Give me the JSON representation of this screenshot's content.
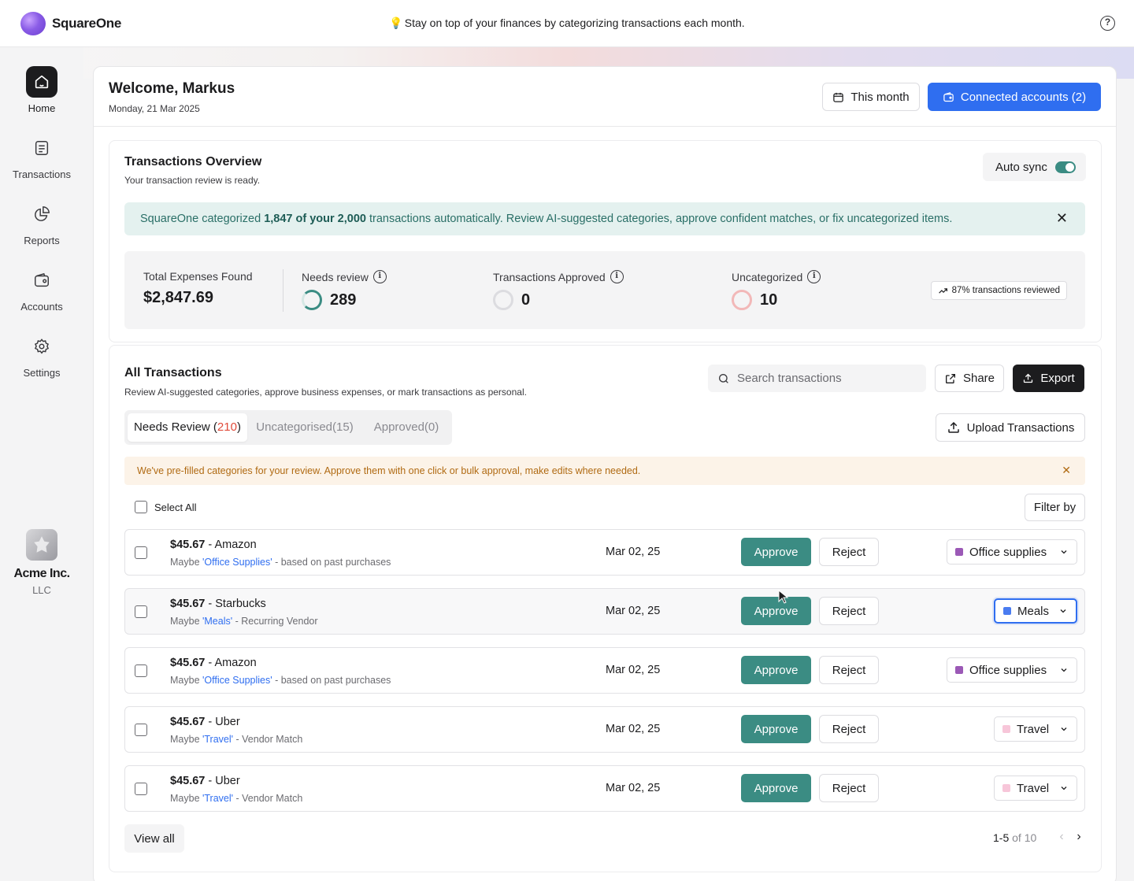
{
  "app": {
    "name": "SquareOne",
    "tip": "Stay on top of your finances by categorizing transactions each month."
  },
  "nav": [
    {
      "label": "Home",
      "active": true
    },
    {
      "label": "Transactions"
    },
    {
      "label": "Reports"
    },
    {
      "label": "Accounts"
    },
    {
      "label": "Settings"
    }
  ],
  "company": {
    "name": "Acme Inc.",
    "type": "LLC"
  },
  "header": {
    "welcome": "Welcome, Markus",
    "date": "Monday, 21 Mar 2025",
    "period_button": "This month",
    "connected_button": "Connected accounts (2)"
  },
  "overview": {
    "title": "Transactions Overview",
    "subtitle": "Your transaction review is ready.",
    "auto_sync_label": "Auto sync",
    "auto_sync_on": true,
    "banner_pre": "SquareOne categorized ",
    "banner_bold": "1,847 of your 2,000",
    "banner_post": " transactions automatically. Review AI-suggested categories, approve confident matches, or fix uncategorized items.",
    "stats": {
      "total_label": "Total Expenses Found",
      "total_value": "$2,847.69",
      "needs_review_label": "Needs review",
      "needs_review_value": "289",
      "approved_label": "Transactions Approved",
      "approved_value": "0",
      "uncategorized_label": "Uncategorized",
      "uncategorized_value": "10",
      "reviewed_badge": "87% transactions reviewed"
    }
  },
  "transactions": {
    "title": "All Transactions",
    "subtitle": "Review AI-suggested categories, approve business expenses, or mark transactions as personal.",
    "search_placeholder": "Search transactions",
    "share_label": "Share",
    "export_label": "Export",
    "upload_label": "Upload Transactions",
    "tabs": {
      "needs_review_prefix": "Needs Review (",
      "needs_review_count": "210",
      "needs_review_suffix": ")",
      "uncategorised": "Uncategorised(15)",
      "approved": "Approved(0)"
    },
    "notice": "We've pre-filled categories for your review. Approve them with one click or bulk approval, make edits where needed.",
    "select_all_label": "Select All",
    "filter_label": "Filter by",
    "approve_label": "Approve",
    "reject_label": "Reject",
    "rows": [
      {
        "amount": "$45.67",
        "vendor": " - Amazon",
        "hint_pre": "Maybe ",
        "hint_cat": "'Office Supplies'",
        "hint_post": " - based on past purchases",
        "date": "Mar 02, 25",
        "category": "Office supplies",
        "color": "#9b59b6"
      },
      {
        "amount": "$45.67",
        "vendor": " - Starbucks",
        "hint_pre": "Maybe ",
        "hint_cat": "'Meals'",
        "hint_post": " - Recurring Vendor",
        "date": "Mar 02, 25",
        "category": "Meals",
        "color": "#4a7cf0"
      },
      {
        "amount": "$45.67",
        "vendor": " - Amazon",
        "hint_pre": "Maybe ",
        "hint_cat": "'Office Supplies'",
        "hint_post": " - based on past purchases",
        "date": "Mar 02, 25",
        "category": "Office supplies",
        "color": "#9b59b6"
      },
      {
        "amount": "$45.67",
        "vendor": " - Uber",
        "hint_pre": "Maybe ",
        "hint_cat": "'Travel'",
        "hint_post": " - Vendor Match",
        "date": "Mar 02, 25",
        "category": "Travel",
        "color": "#f7c6d9"
      },
      {
        "amount": "$45.67",
        "vendor": " - Uber",
        "hint_pre": "Maybe ",
        "hint_cat": "'Travel'",
        "hint_post": " - Vendor Match",
        "date": "Mar 02, 25",
        "category": "Travel",
        "color": "#f7c6d9"
      }
    ],
    "view_all_label": "View all",
    "pager_range": "1-5",
    "pager_total": " of 10"
  }
}
